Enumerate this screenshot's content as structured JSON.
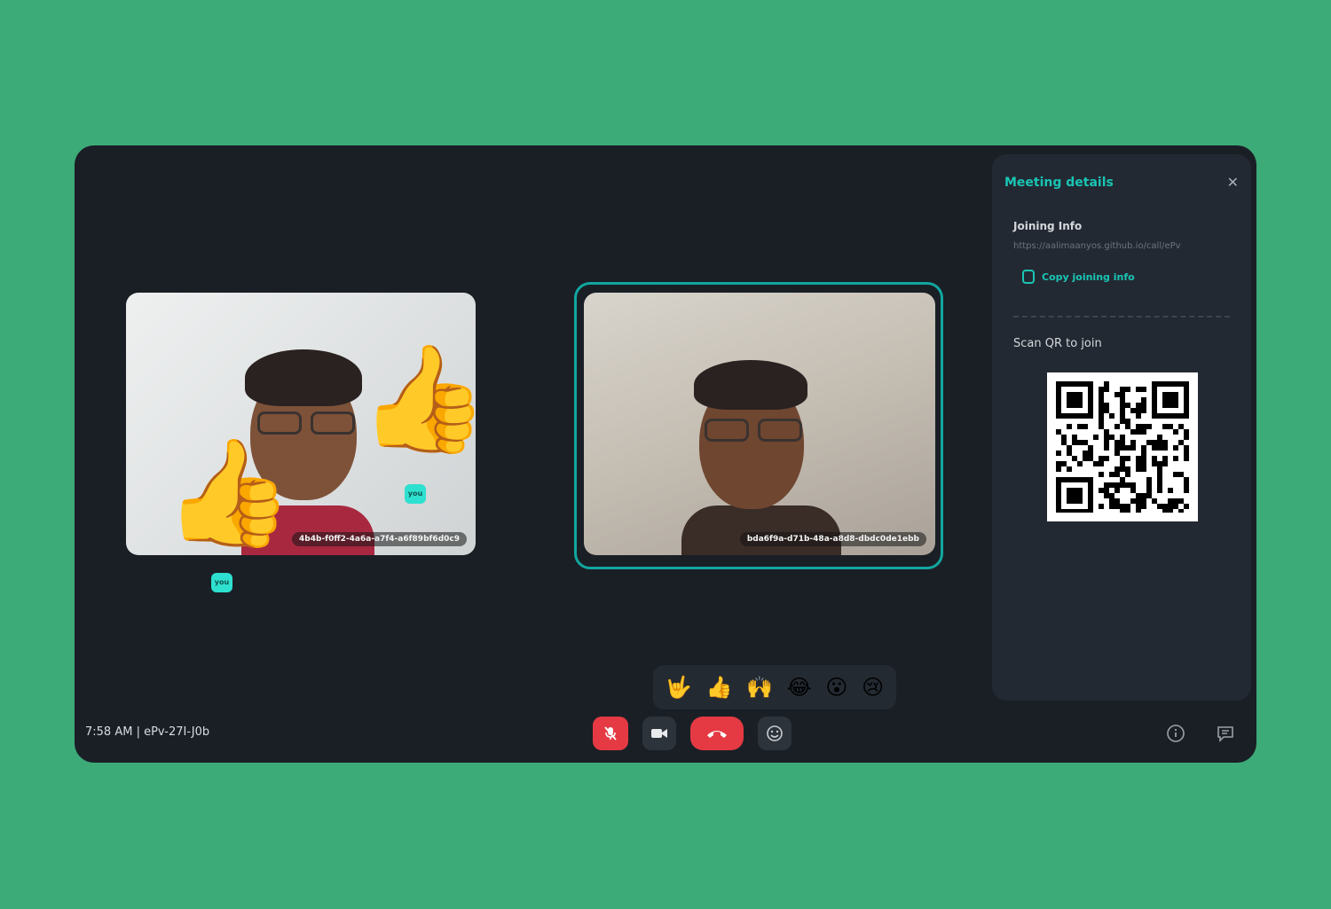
{
  "panel": {
    "title": "Meeting details",
    "joining_label": "Joining Info",
    "joining_url": "https://aalimaanyos.github.io/call/ePv",
    "copy_label": "Copy joining info",
    "scan_label": "Scan QR to join"
  },
  "participants": [
    {
      "name": "4b4b-f0ff2-4a6a-a7f4-a6f89bf6d0c9"
    },
    {
      "name": "bda6f9a-d71b-48a-a8d8-dbdc0de1ebb"
    }
  ],
  "badges": [
    "you",
    "you"
  ],
  "reactions": [
    "🤟",
    "👍",
    "🙌",
    "😂",
    "😮",
    "😢"
  ],
  "status": "7:58 AM | ePv-27I-J0b",
  "floating_emojis": [
    "👍",
    "👍"
  ],
  "colors": {
    "accent": "#19c5b4",
    "danger": "#e53a43",
    "background": "#3dab78"
  },
  "icons": {
    "mic": "mic-off-icon",
    "cam": "video-camera-icon",
    "end": "phone-hangup-icon",
    "emoji": "smiley-icon",
    "info": "info-icon",
    "chat": "chat-icon",
    "close": "close-icon",
    "copy": "copy-icon"
  }
}
